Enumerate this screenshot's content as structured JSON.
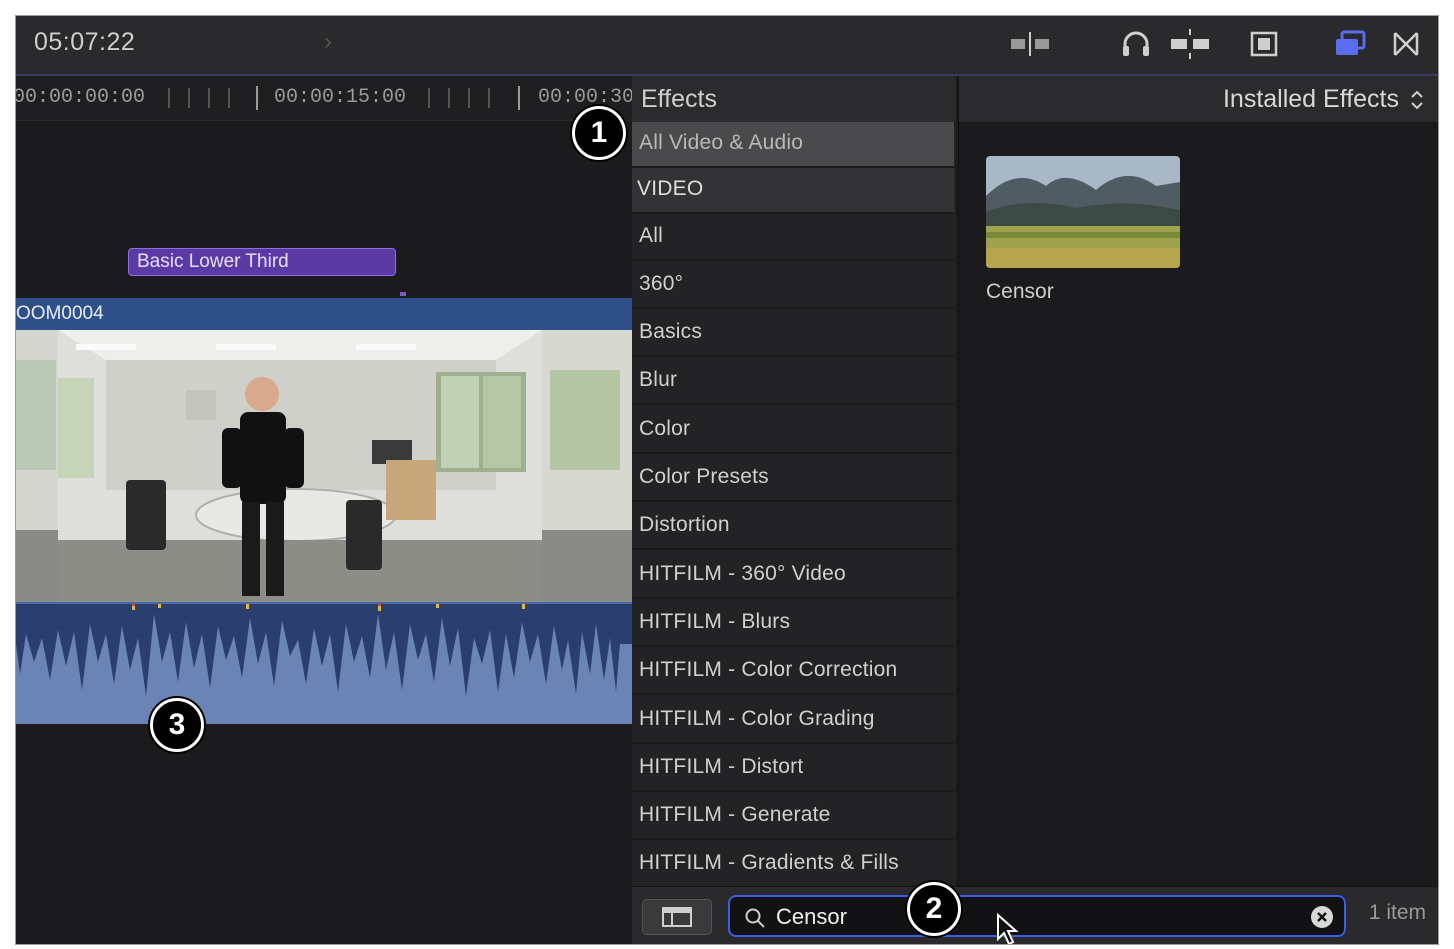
{
  "toolbar": {
    "timecode": "05:07:22",
    "icons": [
      "skimming-icon",
      "audio-skimming-icon",
      "snapping-icon",
      "clip-appearance-icon",
      "effects-browser-icon",
      "transitions-browser-icon"
    ],
    "accent": "#5a6cf0"
  },
  "timeline": {
    "ruler_labels": [
      "00:00:00:00",
      "00:00:15:00",
      "00:00:30"
    ],
    "title_clip": "Basic Lower Third",
    "clip_name": "OOM0004"
  },
  "effects": {
    "header": "Effects",
    "categories": [
      {
        "label": "All Video & Audio",
        "state": "selected"
      },
      {
        "label": "VIDEO",
        "state": "section"
      },
      {
        "label": "All"
      },
      {
        "label": "360°"
      },
      {
        "label": "Basics"
      },
      {
        "label": "Blur"
      },
      {
        "label": "Color"
      },
      {
        "label": "Color Presets"
      },
      {
        "label": "Distortion"
      },
      {
        "label": "HITFILM - 360° Video"
      },
      {
        "label": "HITFILM - Blurs"
      },
      {
        "label": "HITFILM - Color Correction"
      },
      {
        "label": "HITFILM - Color Grading"
      },
      {
        "label": "HITFILM - Distort"
      },
      {
        "label": "HITFILM - Generate"
      },
      {
        "label": "HITFILM - Gradients & Fills"
      }
    ],
    "filter_menu": "Installed Effects",
    "results": [
      {
        "name": "Censor"
      }
    ],
    "search_value": "Censor",
    "item_count": "1 item"
  },
  "callouts": [
    "1",
    "2",
    "3"
  ]
}
